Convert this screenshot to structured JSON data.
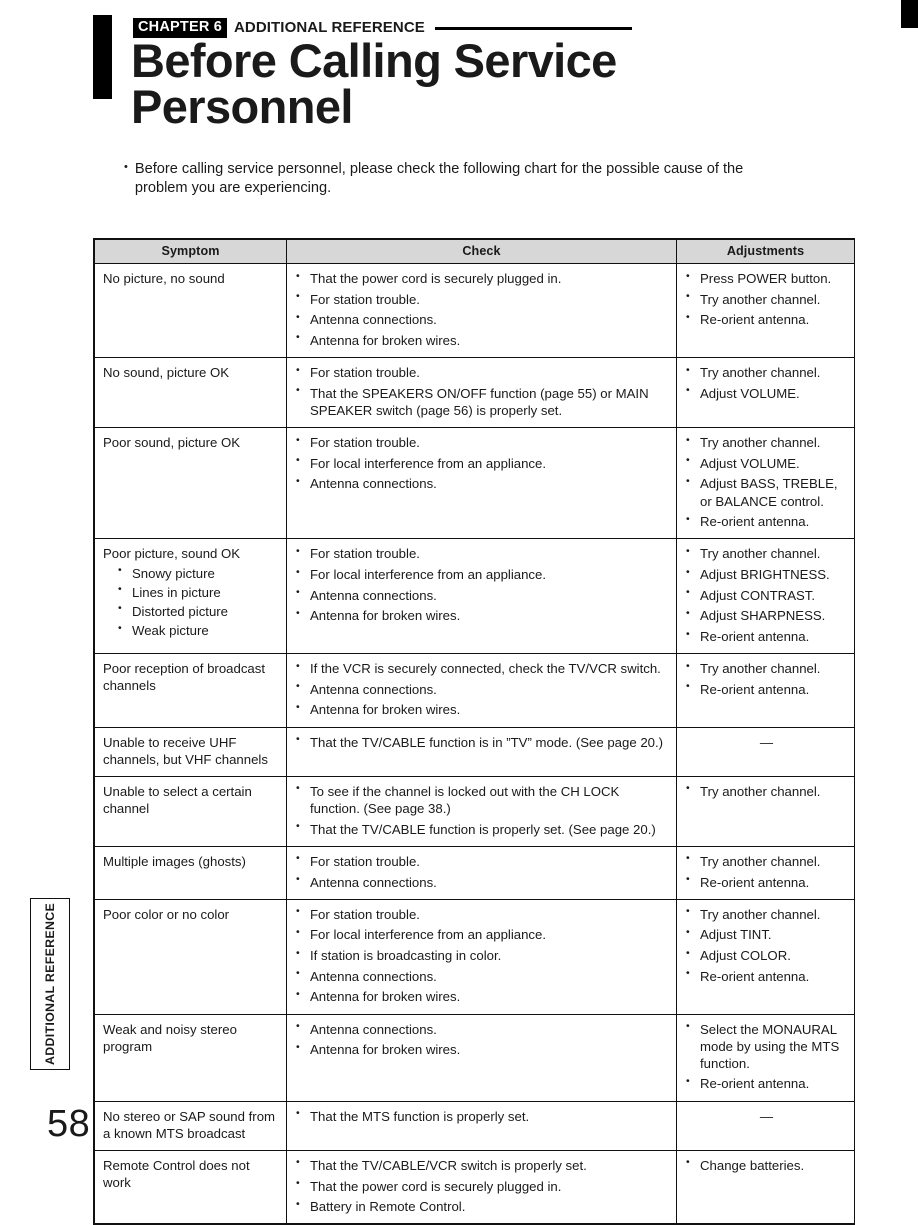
{
  "header": {
    "chapter_badge": "CHAPTER 6",
    "chapter_subtitle": "ADDITIONAL REFERENCE",
    "title": "Before Calling Service Personnel"
  },
  "intro": {
    "bullet_glyph": "•",
    "text": "Before calling service personnel, please check the following chart for the possible cause of the problem you are experiencing."
  },
  "table": {
    "columns": [
      "Symptom",
      "Check",
      "Adjustments"
    ],
    "dash": "—",
    "rows": [
      {
        "symptom": "No picture, no sound",
        "symptom_sub": [],
        "check": [
          "That the power cord is securely plugged in.",
          "For station trouble.",
          "Antenna connections.",
          "Antenna for broken wires."
        ],
        "adjustments": [
          "Press POWER button.",
          "Try another channel.",
          "Re-orient antenna."
        ]
      },
      {
        "symptom": "No sound, picture OK",
        "symptom_sub": [],
        "check": [
          "For station trouble.",
          "That the SPEAKERS ON/OFF function (page 55) or MAIN SPEAKER switch (page 56) is properly set."
        ],
        "adjustments": [
          "Try another channel.",
          "Adjust VOLUME."
        ]
      },
      {
        "symptom": "Poor sound, picture OK",
        "symptom_sub": [],
        "check": [
          "For station trouble.",
          "For local interference from an appliance.",
          "Antenna connections."
        ],
        "adjustments": [
          "Try another channel.",
          "Adjust VOLUME.",
          "Adjust BASS, TREBLE, or BALANCE control.",
          "Re-orient antenna."
        ]
      },
      {
        "symptom": "Poor picture, sound OK",
        "symptom_sub": [
          "Snowy picture",
          "Lines in picture",
          "Distorted picture",
          "Weak picture"
        ],
        "check": [
          "For station trouble.",
          "For local interference from an appliance.",
          "Antenna connections.",
          "Antenna for broken wires."
        ],
        "adjustments": [
          "Try another channel.",
          "Adjust BRIGHTNESS.",
          "Adjust CONTRAST.",
          "Adjust SHARPNESS.",
          "Re-orient antenna."
        ]
      },
      {
        "symptom": "Poor reception of broadcast channels",
        "symptom_sub": [],
        "check": [
          "If the VCR is securely connected, check the TV/VCR switch.",
          "Antenna connections.",
          "Antenna for broken wires."
        ],
        "adjustments": [
          "Try another channel.",
          "Re-orient antenna."
        ]
      },
      {
        "symptom": "Unable to receive UHF channels, but VHF channels",
        "symptom_sub": [],
        "check": [
          "That the TV/CABLE function is in ”TV” mode. (See page 20.)"
        ],
        "adjustments": []
      },
      {
        "symptom": "Unable to select a certain channel",
        "symptom_sub": [],
        "check": [
          "To see if the channel is locked out with the CH LOCK function. (See page 38.)",
          "That the TV/CABLE function is properly set. (See page 20.)"
        ],
        "adjustments": [
          "Try another channel."
        ]
      },
      {
        "symptom": "Multiple images (ghosts)",
        "symptom_sub": [],
        "check": [
          "For station trouble.",
          "Antenna connections."
        ],
        "adjustments": [
          "Try another channel.",
          "Re-orient antenna."
        ]
      },
      {
        "symptom": "Poor color or no color",
        "symptom_sub": [],
        "check": [
          "For station trouble.",
          "For local interference from an appliance.",
          "If station is broadcasting in color.",
          "Antenna connections.",
          "Antenna for broken wires."
        ],
        "adjustments": [
          "Try another channel.",
          "Adjust TINT.",
          "Adjust COLOR.",
          "Re-orient antenna."
        ]
      },
      {
        "symptom": "Weak and noisy stereo program",
        "symptom_sub": [],
        "check": [
          "Antenna connections.",
          "Antenna for broken wires."
        ],
        "adjustments": [
          "Select the MONAURAL mode by using the MTS function.",
          "Re-orient antenna."
        ]
      },
      {
        "symptom": "No stereo or SAP sound from a known MTS broadcast",
        "symptom_sub": [],
        "check": [
          "That the MTS function is properly set."
        ],
        "adjustments": []
      },
      {
        "symptom": "Remote Control does not work",
        "symptom_sub": [],
        "check": [
          "That the TV/CABLE/VCR switch is properly set.",
          "That the power cord is securely plugged in.",
          "Battery in Remote Control."
        ],
        "adjustments": [
          "Change batteries."
        ]
      }
    ]
  },
  "side_tab": {
    "label": "ADDITIONAL REFERENCE"
  },
  "footer": {
    "page_number": "58"
  }
}
